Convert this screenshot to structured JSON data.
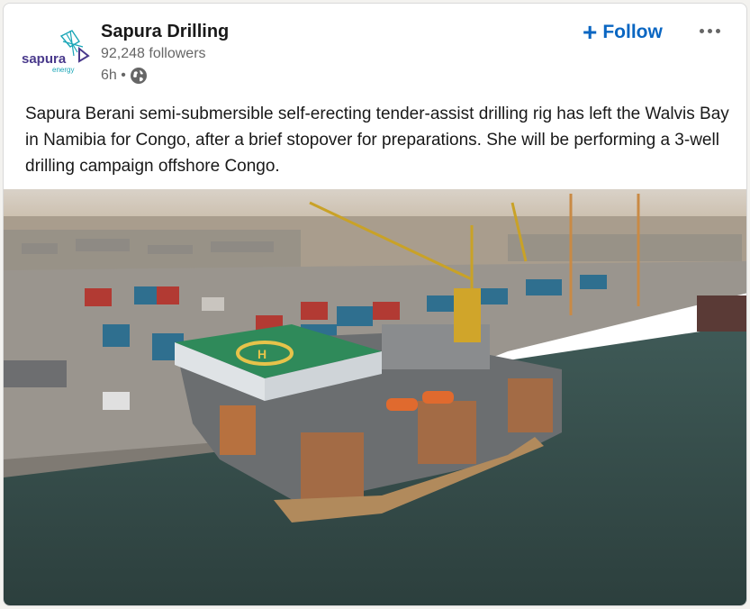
{
  "post": {
    "author": {
      "name": "Sapura Drilling",
      "followers": "92,248 followers",
      "logo_text": "sapura",
      "logo_subtext": "energy"
    },
    "time": "6h •",
    "visibility_icon": "globe-icon",
    "follow_label": "Follow",
    "more_icon": "ellipsis-icon",
    "body": "Sapura Berani semi-submersible self-erecting tender-assist drilling rig has left the Walvis Bay in Namibia for Congo, after a brief stopover for preparations. She will be performing a 3-well drilling campaign offshore Congo.",
    "image_subject": "photo-drilling-rig-in-harbor"
  },
  "colors": {
    "accent": "#0a66c2",
    "text": "#191919",
    "muted": "#666666",
    "logo_teal": "#1aa6b7",
    "logo_purple": "#4a3a8c"
  }
}
